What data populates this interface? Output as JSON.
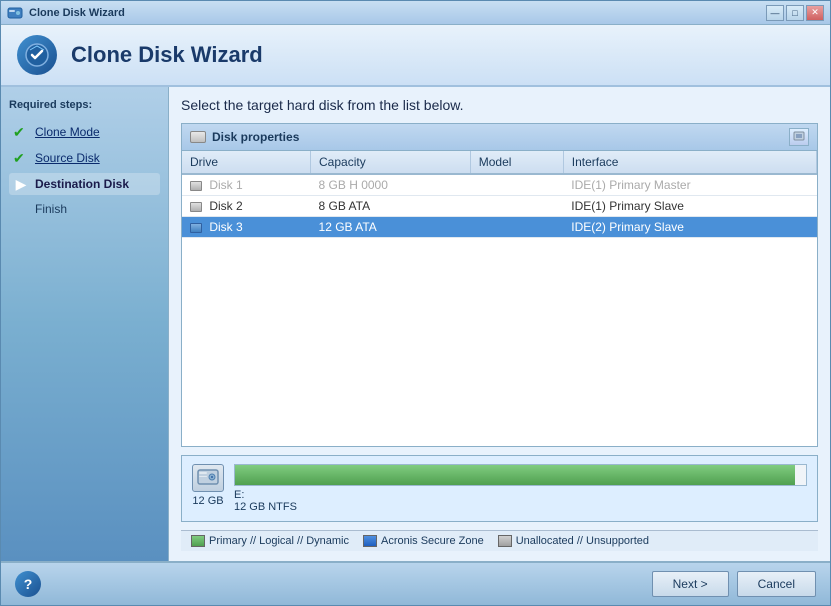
{
  "window": {
    "title": "Clone Disk Wizard",
    "header_title": "Clone Disk Wizard",
    "min_btn": "—",
    "max_btn": "□",
    "close_btn": "✕"
  },
  "sidebar": {
    "required_steps_label": "Required steps:",
    "items": [
      {
        "id": "clone-mode",
        "label": "Clone Mode",
        "state": "done"
      },
      {
        "id": "source-disk",
        "label": "Source Disk",
        "state": "done"
      },
      {
        "id": "destination-disk",
        "label": "Destination Disk",
        "state": "active"
      },
      {
        "id": "finish",
        "label": "Finish",
        "state": "normal"
      }
    ]
  },
  "content": {
    "instruction": "Select the target hard disk from the list below.",
    "disk_panel": {
      "title": "Disk properties",
      "columns": [
        "Drive",
        "Capacity",
        "Model",
        "Interface"
      ],
      "rows": [
        {
          "id": 1,
          "drive": "Disk 1",
          "capacity": "8 GB H 0000",
          "model": "",
          "interface": "IDE(1) Primary Master",
          "state": "disabled",
          "icon": "gray"
        },
        {
          "id": 2,
          "drive": "Disk 2",
          "capacity": "8 GB ATA",
          "model": "",
          "interface": "IDE(1) Primary Slave",
          "state": "normal",
          "icon": "gray"
        },
        {
          "id": 3,
          "drive": "Disk 3",
          "capacity": "12 GB ATA",
          "model": "",
          "interface": "IDE(2) Primary Slave",
          "state": "selected",
          "icon": "blue"
        }
      ]
    },
    "bottom_info": {
      "size_label": "12 GB",
      "partition_label": "E:",
      "partition_size": "12 GB  NTFS"
    },
    "legend": {
      "items": [
        {
          "id": "primary",
          "color": "green",
          "label": "Primary // Logical // Dynamic"
        },
        {
          "id": "acronis",
          "color": "blue",
          "label": "Acronis Secure Zone"
        },
        {
          "id": "unallocated",
          "color": "gray",
          "label": "Unallocated // Unsupported"
        }
      ]
    }
  },
  "footer": {
    "next_btn": "Next >",
    "cancel_btn": "Cancel",
    "help_icon": "?"
  }
}
